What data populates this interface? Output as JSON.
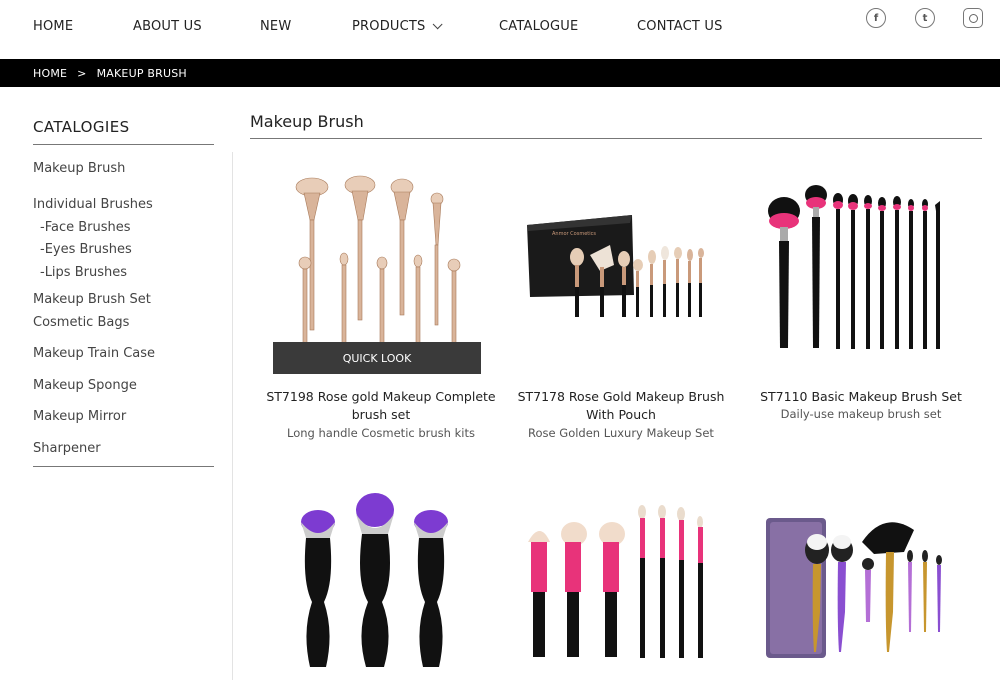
{
  "nav": {
    "items": [
      {
        "label": "HOME"
      },
      {
        "label": "ABOUT US"
      },
      {
        "label": "NEW"
      },
      {
        "label": "PRODUCTS"
      },
      {
        "label": "CATALOGUE"
      },
      {
        "label": "CONTACT US"
      }
    ],
    "social": [
      "facebook-icon",
      "twitter-icon",
      "instagram-icon"
    ]
  },
  "breadcrumb": {
    "home": "HOME",
    "separator": ">",
    "current": "MAKEUP BRUSH"
  },
  "sidebar": {
    "title": "CATALOGIES",
    "items": [
      {
        "label": "Makeup Brush"
      },
      {
        "label": "Individual Brushes"
      },
      {
        "label": "-Face Brushes"
      },
      {
        "label": "-Eyes Brushes"
      },
      {
        "label": "-Lips Brushes"
      },
      {
        "label": "Makeup Brush Set"
      },
      {
        "label": "Cosmetic Bags"
      },
      {
        "label": "Makeup Train Case"
      },
      {
        "label": "Makeup Sponge"
      },
      {
        "label": "Makeup Mirror"
      },
      {
        "label": "Sharpener"
      }
    ]
  },
  "main": {
    "title": "Makeup Brush",
    "quick_look": "QUICK LOOK",
    "products": [
      {
        "name_line1": "ST7198 Rose gold Makeup Complete",
        "name_line2": "brush set",
        "subtitle": "Long handle Cosmetic brush kits"
      },
      {
        "name_line1": "ST7178 Rose Gold Makeup Brush",
        "name_line2": "With Pouch",
        "subtitle": "Rose Golden Luxury Makeup Set"
      },
      {
        "name_line1": "ST7110 Basic Makeup Brush Set",
        "name_line2": "",
        "subtitle": "Daily-use makeup brush set"
      },
      {
        "name_line1": "",
        "name_line2": "",
        "subtitle": ""
      },
      {
        "name_line1": "",
        "name_line2": "",
        "subtitle": ""
      },
      {
        "name_line1": "",
        "name_line2": "",
        "subtitle": ""
      }
    ]
  },
  "colors": {
    "rose_gold": "#c9997a",
    "pink": "#e8337a",
    "purple": "#7d3bd1",
    "black": "#111111",
    "bar": "#000000"
  }
}
